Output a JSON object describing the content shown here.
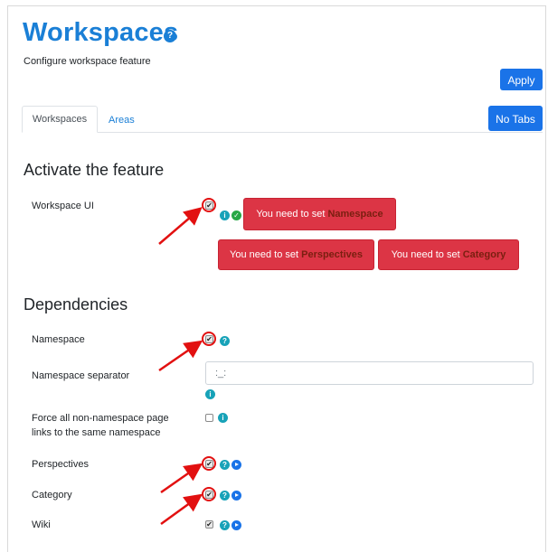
{
  "page": {
    "title": "Workspaces",
    "title_help_icon": "help-icon",
    "subtitle": "Configure workspace feature",
    "apply_label": "Apply",
    "no_tabs_label": "No Tabs"
  },
  "tabs": [
    {
      "label": "Workspaces",
      "active": true
    },
    {
      "label": "Areas",
      "active": false
    }
  ],
  "activate": {
    "heading": "Activate the feature",
    "workspace_ui_label": "Workspace UI",
    "workspace_ui_checked": true,
    "alerts": [
      {
        "prefix": "You need to set",
        "emphasis": "Namespace"
      },
      {
        "prefix": "You need to set",
        "emphasis": "Perspectives"
      },
      {
        "prefix": "You need to set",
        "emphasis": "Category"
      }
    ]
  },
  "dependencies": {
    "heading": "Dependencies",
    "rows": [
      {
        "label": "Namespace",
        "checked": true
      },
      {
        "label": "Namespace separator",
        "value": ":_:"
      },
      {
        "label_line1": "Force all non-namespace page",
        "label_line2": "links to the same namespace",
        "checked": false
      },
      {
        "label": "Perspectives",
        "checked": true
      },
      {
        "label": "Category",
        "checked": true
      },
      {
        "label": "Wiki",
        "checked": true
      }
    ]
  },
  "colors": {
    "primary": "#1a73e8",
    "title": "#1a7fd6",
    "danger": "#dc3545",
    "annotation": "#e21010",
    "info": "#17a2b8",
    "success": "#28a745"
  }
}
